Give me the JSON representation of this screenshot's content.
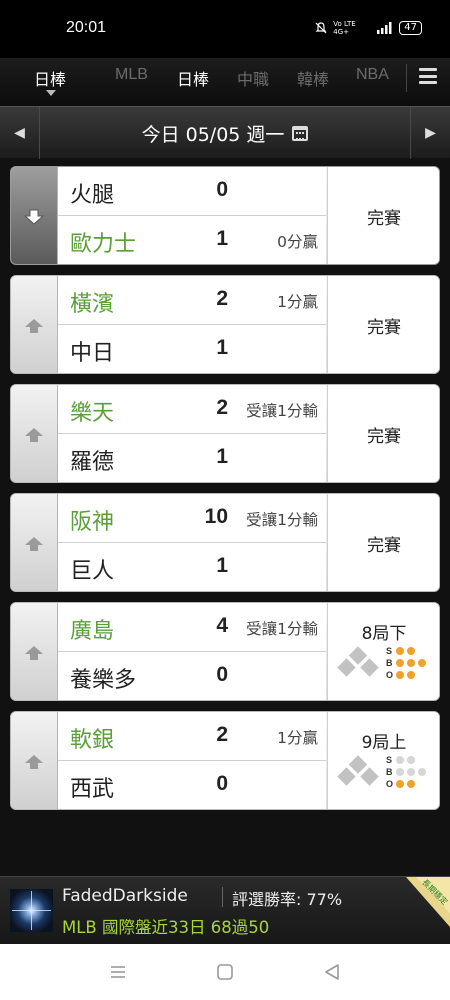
{
  "status_bar": {
    "time": "20:01",
    "signal_text": "Vo LTE 4G+",
    "battery": "47"
  },
  "tabs": [
    {
      "label": "日棒",
      "active": true
    },
    {
      "label": "MLB",
      "active": false
    },
    {
      "label": "日棒",
      "active": true
    },
    {
      "label": "中職",
      "active": false
    },
    {
      "label": "韓棒",
      "active": false
    },
    {
      "label": "NBA",
      "active": false
    }
  ],
  "date_bar": {
    "prev": "◀",
    "date": "今日 05/05 週一",
    "next": "▶"
  },
  "games": [
    {
      "top": {
        "team": "火腿",
        "score": "0",
        "note": "",
        "win": false
      },
      "bottom": {
        "team": "歐力士",
        "score": "1",
        "note": "0分贏",
        "win": true
      },
      "status": "完賽",
      "arrow": "down"
    },
    {
      "top": {
        "team": "橫濱",
        "score": "2",
        "note": "1分贏",
        "win": true
      },
      "bottom": {
        "team": "中日",
        "score": "1",
        "note": "",
        "win": false
      },
      "status": "完賽",
      "arrow": "up"
    },
    {
      "top": {
        "team": "樂天",
        "score": "2",
        "note": "受讓1分輸",
        "win": true
      },
      "bottom": {
        "team": "羅德",
        "score": "1",
        "note": "",
        "win": false
      },
      "status": "完賽",
      "arrow": "up"
    },
    {
      "top": {
        "team": "阪神",
        "score": "10",
        "note": "受讓1分輸",
        "win": true
      },
      "bottom": {
        "team": "巨人",
        "score": "1",
        "note": "",
        "win": false
      },
      "status": "完賽",
      "arrow": "up"
    },
    {
      "top": {
        "team": "廣島",
        "score": "4",
        "note": "受讓1分輸",
        "win": true
      },
      "bottom": {
        "team": "養樂多",
        "score": "0",
        "note": "",
        "win": false
      },
      "status": "8局下",
      "arrow": "up",
      "live": true,
      "sbo": {
        "S": 2,
        "B": 3,
        "O": 2
      }
    },
    {
      "top": {
        "team": "軟銀",
        "score": "2",
        "note": "1分贏",
        "win": true
      },
      "bottom": {
        "team": "西武",
        "score": "0",
        "note": "",
        "win": false
      },
      "status": "9局上",
      "arrow": "up",
      "live": true,
      "sbo": {
        "S": 0,
        "B": 0,
        "O": 2
      }
    }
  ],
  "sbo_labels": [
    "S",
    "B",
    "O"
  ],
  "banner": {
    "username": "FadedDarkside",
    "win_rate": "評選勝率: 77%",
    "record": "MLB 國際盤近33日 68過50",
    "corner_label": "長期穩定"
  },
  "colors": {
    "win_team": "#5aa038",
    "dot_on": "#f2a22a",
    "record_text": "#a7d63c"
  }
}
